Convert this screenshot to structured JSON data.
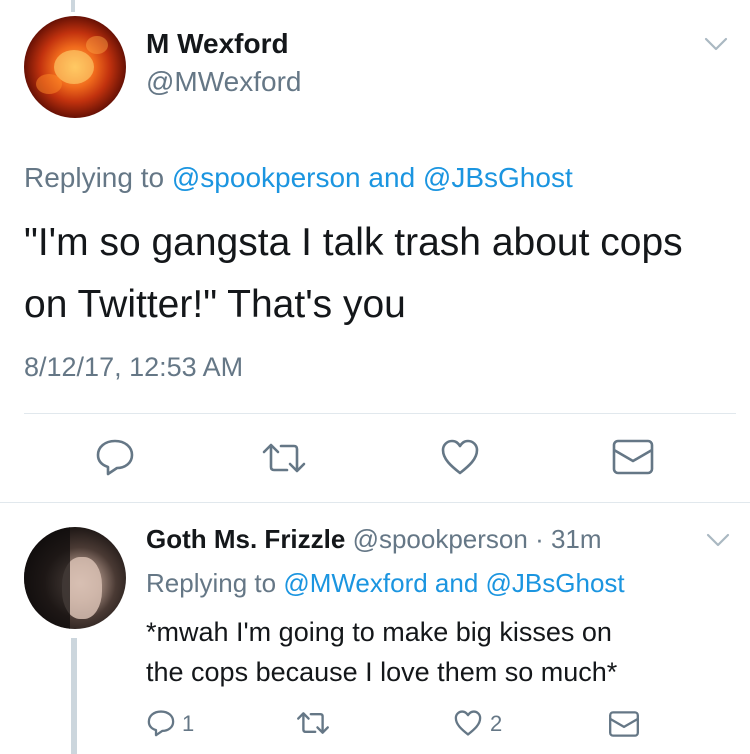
{
  "tweet_main": {
    "display_name": "M Wexford",
    "handle": "@MWexford",
    "replying_prefix": "Replying to ",
    "replying_to_1": "@spookperson",
    "replying_and": " and ",
    "replying_to_2": "@JBsGhost",
    "text_line_1": "\"I'm so gangsta I talk trash about cops",
    "text_line_2": "on Twitter!\" That's you",
    "timestamp": "8/12/17, 12:53 AM",
    "actions": [
      "reply-icon",
      "retweet-icon",
      "like-icon",
      "direct-message-icon"
    ]
  },
  "tweet_reply": {
    "display_name": "Goth Ms. Frizzle",
    "handle": "@spookperson",
    "separator": " · ",
    "age": "31m",
    "replying_prefix": "Replying to ",
    "replying_to_1": "@MWexford",
    "replying_and": " and ",
    "replying_to_2": "@JBsGhost",
    "text_line_1": "*mwah I'm going to make big kisses on",
    "text_line_2": "the cops because I love them so much*",
    "reply_count": "1",
    "like_count": "2",
    "actions": [
      "reply-icon",
      "retweet-icon",
      "like-icon",
      "direct-message-icon"
    ]
  },
  "colors": {
    "link": "#1b95e0",
    "secondary_text": "#657786",
    "primary_text": "#14171a",
    "divider": "#e1e8ed",
    "thread_line": "#ccd6dd"
  }
}
